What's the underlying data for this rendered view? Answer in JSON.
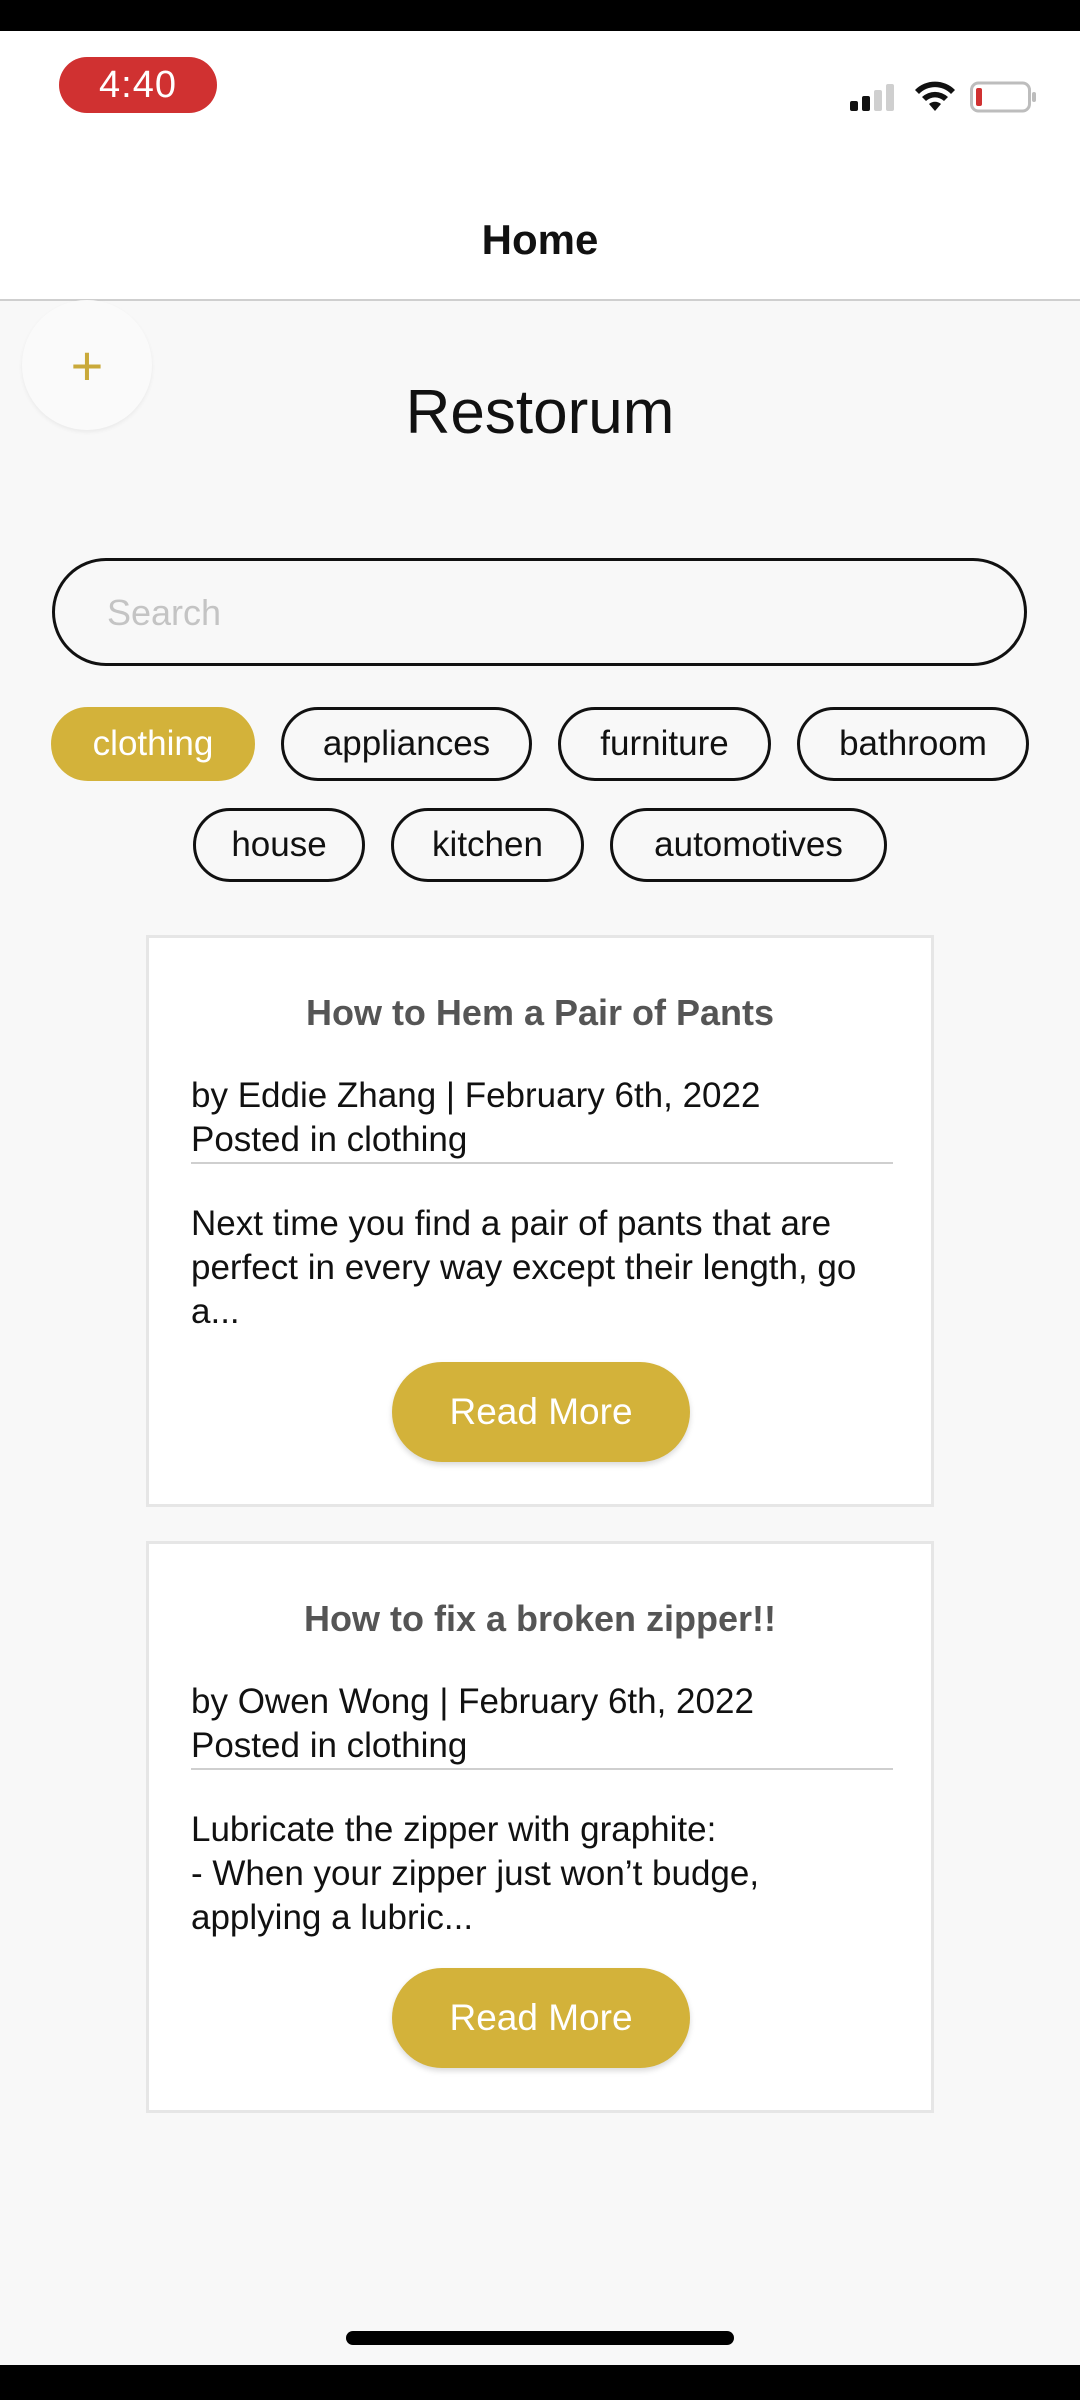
{
  "status_bar": {
    "time": "4:40"
  },
  "nav": {
    "title": "Home"
  },
  "app": {
    "title": "Restorum",
    "add_label": "+"
  },
  "search": {
    "placeholder": "Search",
    "value": ""
  },
  "categories": [
    {
      "label": "clothing",
      "active": true
    },
    {
      "label": "appliances",
      "active": false
    },
    {
      "label": "furniture",
      "active": false
    },
    {
      "label": "bathroom",
      "active": false
    },
    {
      "label": "house",
      "active": false
    },
    {
      "label": "kitchen",
      "active": false
    },
    {
      "label": "automotives",
      "active": false
    }
  ],
  "posts": [
    {
      "title": "How to Hem a Pair of Pants",
      "byline": "by Eddie Zhang | February 6th, 2022",
      "category_line": "Posted in clothing",
      "excerpt": "Next time you find a pair of pants that are perfect in every way except their length, go a...",
      "button_label": "Read More"
    },
    {
      "title": "How to fix a broken zipper!!",
      "byline": "by Owen Wong | February 6th, 2022",
      "category_line": "Posted in clothing",
      "excerpt": "Lubricate the zipper with graphite:\n- When your zipper just won’t budge, applying a lubric...",
      "button_label": "Read More"
    }
  ],
  "colors": {
    "accent": "#d3b23a",
    "time_pill": "#d03131"
  }
}
